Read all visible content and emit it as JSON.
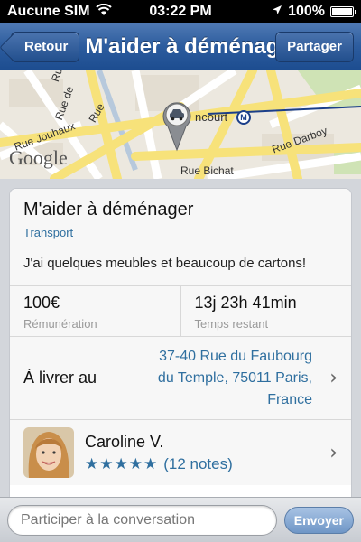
{
  "status_bar": {
    "carrier": "Aucune SIM",
    "time": "03:22 PM",
    "battery": "100%",
    "battery_level": 1.0
  },
  "nav": {
    "back_label": "Retour",
    "title": "M'aider à déménager",
    "share_label": "Partager"
  },
  "map": {
    "labels": [
      "Rue Bea",
      "Rue de",
      "Rue Jouhaux",
      "Rue",
      "ncourt",
      "Rue Darboy",
      "Rue Bichat",
      "Google"
    ],
    "pin_icon": "car-icon",
    "metro_badge": "M"
  },
  "task": {
    "title": "M'aider à déménager",
    "category": "Transport",
    "description": "J'ai quelques meubles et beaucoup de cartons!"
  },
  "stats": {
    "reward_value": "100€",
    "reward_label": "Rémunération",
    "time_value": "13j 23h 41min",
    "time_label": "Temps restant"
  },
  "delivery": {
    "label": "À livrer au",
    "address_line1": "37-40 Rue du Faubourg",
    "address_line2": "du Temple, 75011 Paris,",
    "address_line3": "France"
  },
  "user": {
    "name": "Caroline V.",
    "stars": "★★★★★",
    "rating": 5,
    "notes": "(12 notes)"
  },
  "composer": {
    "placeholder": "Participer à la conversation",
    "send_label": "Envoyer"
  },
  "colors": {
    "nav_blue": "#2c5c9e",
    "link_blue": "#2f6f9f"
  }
}
